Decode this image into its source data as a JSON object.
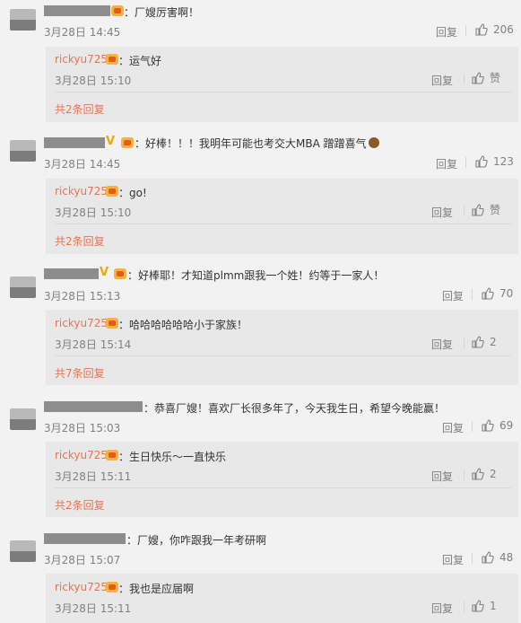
{
  "comments": [
    {
      "text": "：厂嫂厉害啊！",
      "time": "3月28日 14:45",
      "reply_label": "回复",
      "likes": "206",
      "sub": {
        "name": "rickyu725",
        "text": "：运气好",
        "time": "3月28日 15:10",
        "reply_label": "回复",
        "likes": "赞",
        "more": "共2条回复"
      }
    },
    {
      "text": "：好棒！！！我明年可能也考交大MBA 蹭蹭喜气",
      "time": "3月28日 14:45",
      "reply_label": "回复",
      "likes": "123",
      "sub": {
        "name": "rickyu725",
        "text": "：go!",
        "time": "3月28日 15:10",
        "reply_label": "回复",
        "likes": "赞",
        "more": "共2条回复"
      }
    },
    {
      "text": "：好棒耶！才知道plmm跟我一个姓！约等于一家人！",
      "time": "3月28日 15:13",
      "reply_label": "回复",
      "likes": "70",
      "sub": {
        "name": "rickyu725",
        "text": "：哈哈哈哈哈哈小于家族！",
        "time": "3月28日 15:14",
        "reply_label": "回复",
        "likes": "2",
        "more": "共7条回复"
      }
    },
    {
      "text": "：恭喜厂嫂！喜欢厂长很多年了，今天我生日，希望今晚能赢！",
      "time": "3月28日 15:03",
      "reply_label": "回复",
      "likes": "69",
      "sub": {
        "name": "rickyu725",
        "text": "：生日快乐～一直快乐",
        "time": "3月28日 15:11",
        "reply_label": "回复",
        "likes": "2",
        "more": "共2条回复"
      }
    },
    {
      "text": "：厂嫂，你咋跟我一年考研啊",
      "time": "3月28日 15:07",
      "reply_label": "回复",
      "likes": "48",
      "sub": {
        "name": "rickyu725",
        "text": "：我也是应届啊",
        "time": "3月28日 15:11",
        "reply_label": "回复",
        "likes": "1",
        "more": ""
      }
    }
  ],
  "icons": {
    "like": "thumbs-up-icon",
    "badge": "user-badge-icon",
    "vip": "vip-v-icon"
  },
  "colors": {
    "username": "#eb7350",
    "meta": "#808080",
    "background": "#f2f2f2",
    "reply_panel": "#e8e8e8"
  }
}
